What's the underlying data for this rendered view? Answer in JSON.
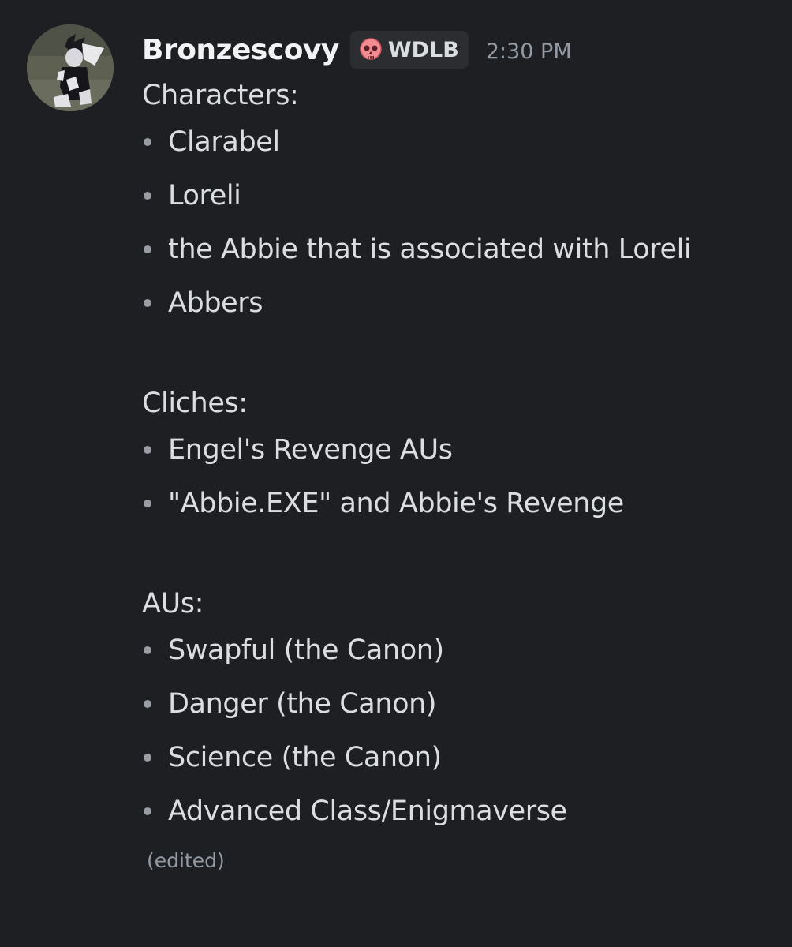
{
  "author": {
    "username": "Bronzescovy",
    "avatar_icon": "character-avatar",
    "tag": {
      "icon": "skull-icon",
      "label": "WDLB"
    },
    "timestamp": "2:30 PM"
  },
  "message": {
    "sections": [
      {
        "heading": "Characters:",
        "items": [
          "Clarabel",
          "Loreli",
          "the Abbie that is associated with Loreli",
          "Abbers"
        ]
      },
      {
        "heading": "Cliches:",
        "items": [
          "Engel's Revenge AUs",
          "\"Abbie.EXE\" and Abbie's Revenge"
        ]
      },
      {
        "heading": "AUs:",
        "items": [
          "Swapful (the Canon)",
          "Danger (the Canon)",
          "Science (the Canon)",
          "Advanced Class/Enigmaverse"
        ]
      }
    ],
    "edited_label": "(edited)"
  },
  "colors": {
    "background": "#1e1f22",
    "text": "#dbdee1",
    "username": "#f2f3f5",
    "muted": "#949ba4",
    "tag_background": "#2b2d31",
    "skull": "#f28b92"
  }
}
